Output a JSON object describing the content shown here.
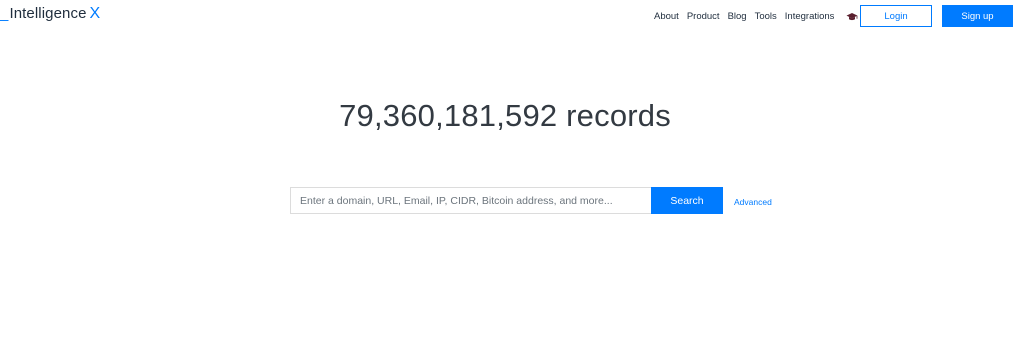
{
  "header": {
    "logo": {
      "prefix": "_",
      "text": "Intelligence",
      "suffix": "X"
    },
    "nav": [
      "About",
      "Product",
      "Blog",
      "Tools",
      "Integrations"
    ],
    "nav_icon": "graduation-cap-icon",
    "login_label": "Login",
    "signup_label": "Sign up"
  },
  "hero": {
    "records_text": "79,360,181,592 records"
  },
  "search": {
    "placeholder": "Enter a domain, URL, Email, IP, CIDR, Bitcoin address, and more...",
    "value": "",
    "button_label": "Search",
    "advanced_label": "Advanced"
  },
  "colors": {
    "accent": "#007bff",
    "text": "#1f2d3d",
    "background": "#ffffff"
  }
}
